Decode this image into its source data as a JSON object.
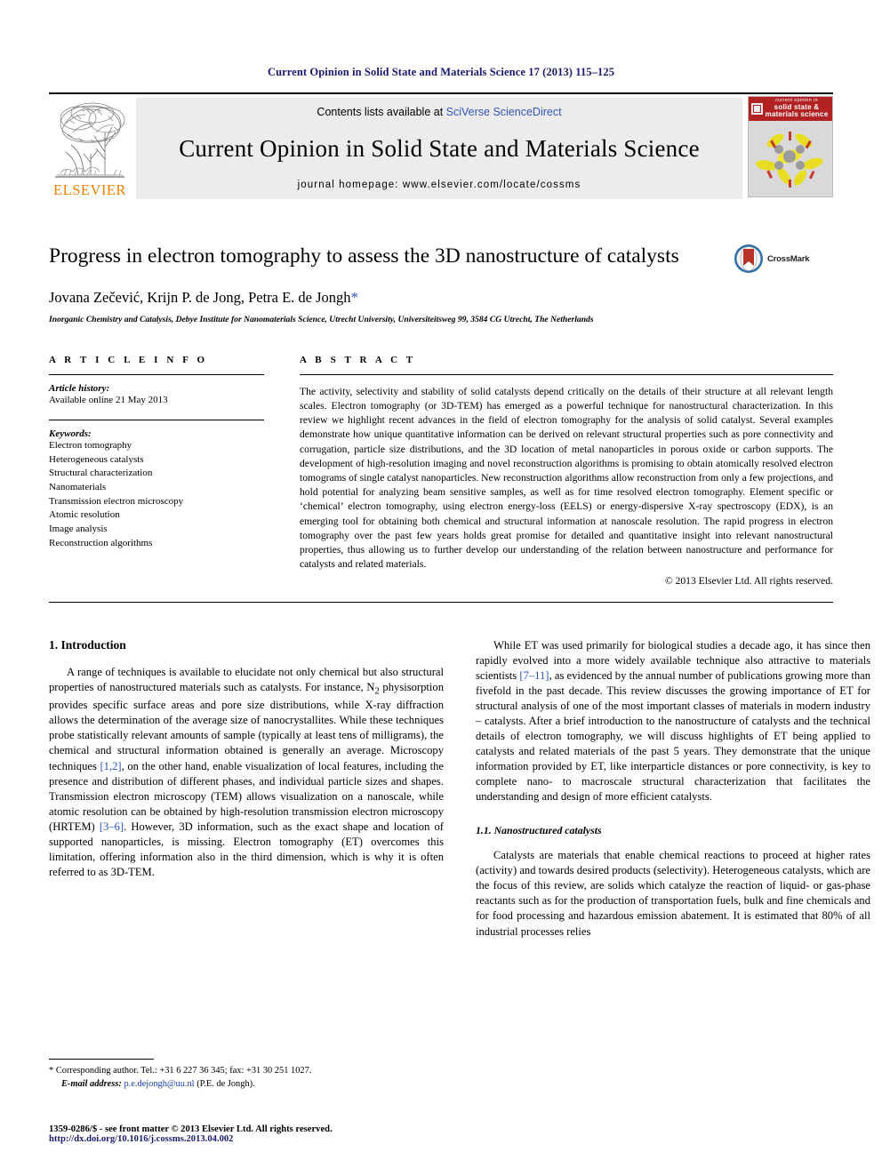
{
  "running_head": "Current Opinion in Solid State and Materials Science 17 (2013) 115–125",
  "masthead": {
    "publisher_name": "ELSEVIER",
    "contents_prefix": "Contents lists available at ",
    "contents_link": "SciVerse ScienceDirect",
    "journal_title": "Current Opinion in Solid State and Materials Science",
    "homepage": "journal homepage: www.elsevier.com/locate/cossms",
    "cover": {
      "line1": "current opinion in",
      "line2": "solid state & materials science"
    }
  },
  "article": {
    "title": "Progress in electron tomography to assess the 3D nanostructure of catalysts",
    "authors": "Jovana Zečević, Krijn P. de Jong, Petra E. de Jongh",
    "corresponding_marker": "*",
    "affiliation": "Inorganic Chemistry and Catalysis, Debye Institute for Nanomaterials Science, Utrecht University, Universiteitsweg 99, 3584 CG Utrecht, The Netherlands",
    "crossmark_label": "CrossMark"
  },
  "article_info": {
    "heading": "A R T I C L E  I N F O",
    "history_label": "Article history:",
    "history_value": "Available online 21 May 2013",
    "keywords_label": "Keywords:",
    "keywords": [
      "Electron tomography",
      "Heterogeneous catalysts",
      "Structural characterization",
      "Nanomaterials",
      "Transmission electron microscopy",
      "Atomic resolution",
      "Image analysis",
      "Reconstruction algorithms"
    ]
  },
  "abstract": {
    "heading": "A B S T R A C T",
    "text": "The activity, selectivity and stability of solid catalysts depend critically on the details of their structure at all relevant length scales. Electron tomography (or 3D-TEM) has emerged as a powerful technique for nanostructural characterization. In this review we highlight recent advances in the field of electron tomography for the analysis of solid catalyst. Several examples demonstrate how unique quantitative information can be derived on relevant structural properties such as pore connectivity and corrugation, particle size distributions, and the 3D location of metal nanoparticles in porous oxide or carbon supports. The development of high-resolution imaging and novel reconstruction algorithms is promising to obtain atomically resolved electron tomograms of single catalyst nanoparticles. New reconstruction algorithms allow reconstruction from only a few projections, and hold potential for analyzing beam sensitive samples, as well as for time resolved electron tomography. Element specific or ‘chemical’ electron tomography, using electron energy-loss (EELS) or energy-dispersive X-ray spectroscopy (EDX), is an emerging tool for obtaining both chemical and structural information at nanoscale resolution. The rapid progress in electron tomography over the past few years holds great promise for detailed and quantitative insight into relevant nanostructural properties, thus allowing us to further develop our understanding of the relation between nanostructure and performance for catalysts and related materials.",
    "copyright": "© 2013 Elsevier Ltd. All rights reserved."
  },
  "body": {
    "section1_heading": "1. Introduction",
    "left_para1_a": "A range of techniques is available to elucidate not only chemical but also structural properties of nanostructured materials such as catalysts. For instance, N",
    "left_para1_sub": "2",
    "left_para1_b": " physisorption provides specific surface areas and pore size distributions, while X-ray diffraction allows the determination of the average size of nanocrystallites. While these techniques probe statistically relevant amounts of sample (typically at least tens of milligrams), the chemical and structural information obtained is generally an average. Microscopy techniques ",
    "left_ref_12": "[1,2]",
    "left_para1_c": ", on the other hand, enable visualization of local features, including the presence and distribution of different phases, and individual particle sizes and shapes. Transmission electron microscopy (TEM) allows visualization on a nanoscale, while atomic resolution can be obtained by high-resolution transmission electron microscopy (HRTEM) ",
    "left_ref_36": "[3–6]",
    "left_para1_d": ". However, 3D information, such as the exact shape and location of supported nanoparticles, is missing. Electron tomography (ET) overcomes this limitation, offering information also in the third dimension, which is why it is often referred to as 3D-TEM.",
    "right_para1_a": "While ET was used primarily for biological studies a decade ago, it has since then rapidly evolved into a more widely available technique also attractive to materials scientists ",
    "right_ref_711": "[7–11]",
    "right_para1_b": ", as evidenced by the annual number of publications growing more than fivefold in the past decade. This review discusses the growing importance of ET for structural analysis of one of the most important classes of materials in modern industry – catalysts. After a brief introduction to the nanostructure of catalysts and the technical details of electron tomography, we will discuss highlights of ET being applied to catalysts and related materials of the past 5 years. They demonstrate that the unique information provided by ET, like interparticle distances or pore connectivity, is key to complete nano- to macroscale structural characterization that facilitates the understanding and design of more efficient catalysts.",
    "section11_heading": "1.1. Nanostructured catalysts",
    "right_para2": "Catalysts are materials that enable chemical reactions to proceed at higher rates (activity) and towards desired products (selectivity). Heterogeneous catalysts, which are the focus of this review, are solids which catalyze the reaction of liquid- or gas-phase reactants such as for the production of transportation fuels, bulk and fine chemicals and for food processing and hazardous emission abatement. It is estimated that 80% of all industrial processes relies"
  },
  "footnote": {
    "star": "*",
    "corresponding": "Corresponding author. Tel.: +31 6 227 36 345; fax: +31 30 251 1027.",
    "email_label": "E-mail address:",
    "email": "p.e.dejongh@uu.nl",
    "email_owner": "(P.E. de Jongh)."
  },
  "footer": {
    "issn_line": "1359-0286/$ - see front matter © 2013 Elsevier Ltd. All rights reserved.",
    "doi_line": "http://dx.doi.org/10.1016/j.cossms.2013.04.002"
  },
  "colors": {
    "link_blue": "#3355bb",
    "ref_blue": "#2b4fbb",
    "running_head_navy": "#1a1a6e",
    "elsevier_orange": "#f08000",
    "cover_red": "#b32222",
    "crossmark_red": "#b8332a",
    "crossmark_blue": "#2f6fa8"
  }
}
